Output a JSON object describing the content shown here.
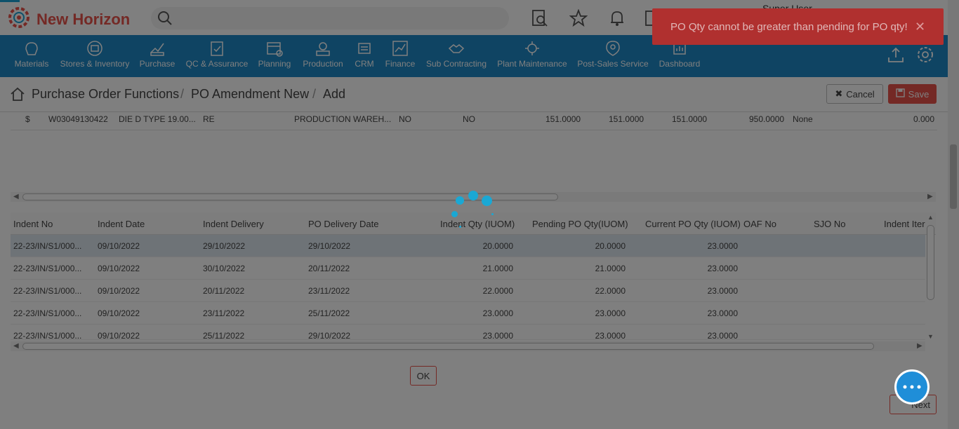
{
  "app": {
    "name": "New Horizon",
    "user": "Super User"
  },
  "colors": {
    "brand_red": "#e8524a",
    "nav_blue": "#1e88c6",
    "spinner": "#1aa8d4",
    "toast_bg": "#b0302f",
    "chat": "#1f8ed8"
  },
  "icons": {
    "logo": "gear-logo-icon",
    "search": "search-icon",
    "doc_search": "document-search-icon",
    "favorite": "star-icon",
    "notify": "bell-icon",
    "upload": "upload-icon",
    "settings": "gear-icon",
    "home": "home-icon",
    "chat": "chat-bubble-icon"
  },
  "search": {
    "value": ""
  },
  "nav": [
    {
      "label": "Materials",
      "icon": "materials-icon"
    },
    {
      "label": "Stores & Inventory",
      "icon": "stores-icon"
    },
    {
      "label": "Purchase",
      "icon": "purchase-icon"
    },
    {
      "label": "QC & Assurance",
      "icon": "qc-icon"
    },
    {
      "label": "Planning",
      "icon": "planning-icon"
    },
    {
      "label": "Production",
      "icon": "production-icon"
    },
    {
      "label": "CRM",
      "icon": "crm-icon"
    },
    {
      "label": "Finance",
      "icon": "finance-icon"
    },
    {
      "label": "Sub Contracting",
      "icon": "subcontracting-icon"
    },
    {
      "label": "Plant Maintenance",
      "icon": "plant-maintenance-icon"
    },
    {
      "label": "Post-Sales Service",
      "icon": "post-sales-icon"
    },
    {
      "label": "Dashboard",
      "icon": "dashboard-icon"
    }
  ],
  "breadcrumb": {
    "module": "Purchase Order Functions",
    "page": "PO Amendment New",
    "action": "Add",
    "sep": "/"
  },
  "actions": {
    "cancel": "Cancel",
    "save": "Save",
    "ok": "OK",
    "next": "Next"
  },
  "upper_row": [
    "$",
    "W03049130422",
    "DIE D TYPE 19.00...",
    "RE",
    "PRODUCTION WAREH...",
    "NO",
    "NO",
    "151.0000",
    "151.0000",
    "151.0000",
    "950.0000",
    "None",
    "0.000"
  ],
  "grid": {
    "columns": [
      "Indent No",
      "Indent Date",
      "Indent Delivery",
      "PO Delivery Date",
      "Indent Qty (IUOM)",
      "Pending PO Qty(IUOM)",
      "Current PO Qty (IUOM)",
      "OAF No",
      "SJO No",
      "Indent Iter"
    ],
    "rows": [
      [
        "22-23/IN/S1/000...",
        "09/10/2022",
        "29/10/2022",
        "29/10/2022",
        "20.0000",
        "20.0000",
        "23.0000"
      ],
      [
        "22-23/IN/S1/000...",
        "09/10/2022",
        "30/10/2022",
        "20/11/2022",
        "21.0000",
        "21.0000",
        "23.0000"
      ],
      [
        "22-23/IN/S1/000...",
        "09/10/2022",
        "20/11/2022",
        "23/11/2022",
        "22.0000",
        "22.0000",
        "23.0000"
      ],
      [
        "22-23/IN/S1/000...",
        "09/10/2022",
        "23/11/2022",
        "25/11/2022",
        "23.0000",
        "23.0000",
        "23.0000"
      ],
      [
        "22-23/IN/S1/000...",
        "09/10/2022",
        "25/11/2022",
        "29/10/2022",
        "23.0000",
        "23.0000",
        "23.0000"
      ]
    ]
  },
  "toast": {
    "message": "PO Qty cannot be greater than pending for PO qty!",
    "close": "✕"
  },
  "chat": {
    "label": "···"
  }
}
